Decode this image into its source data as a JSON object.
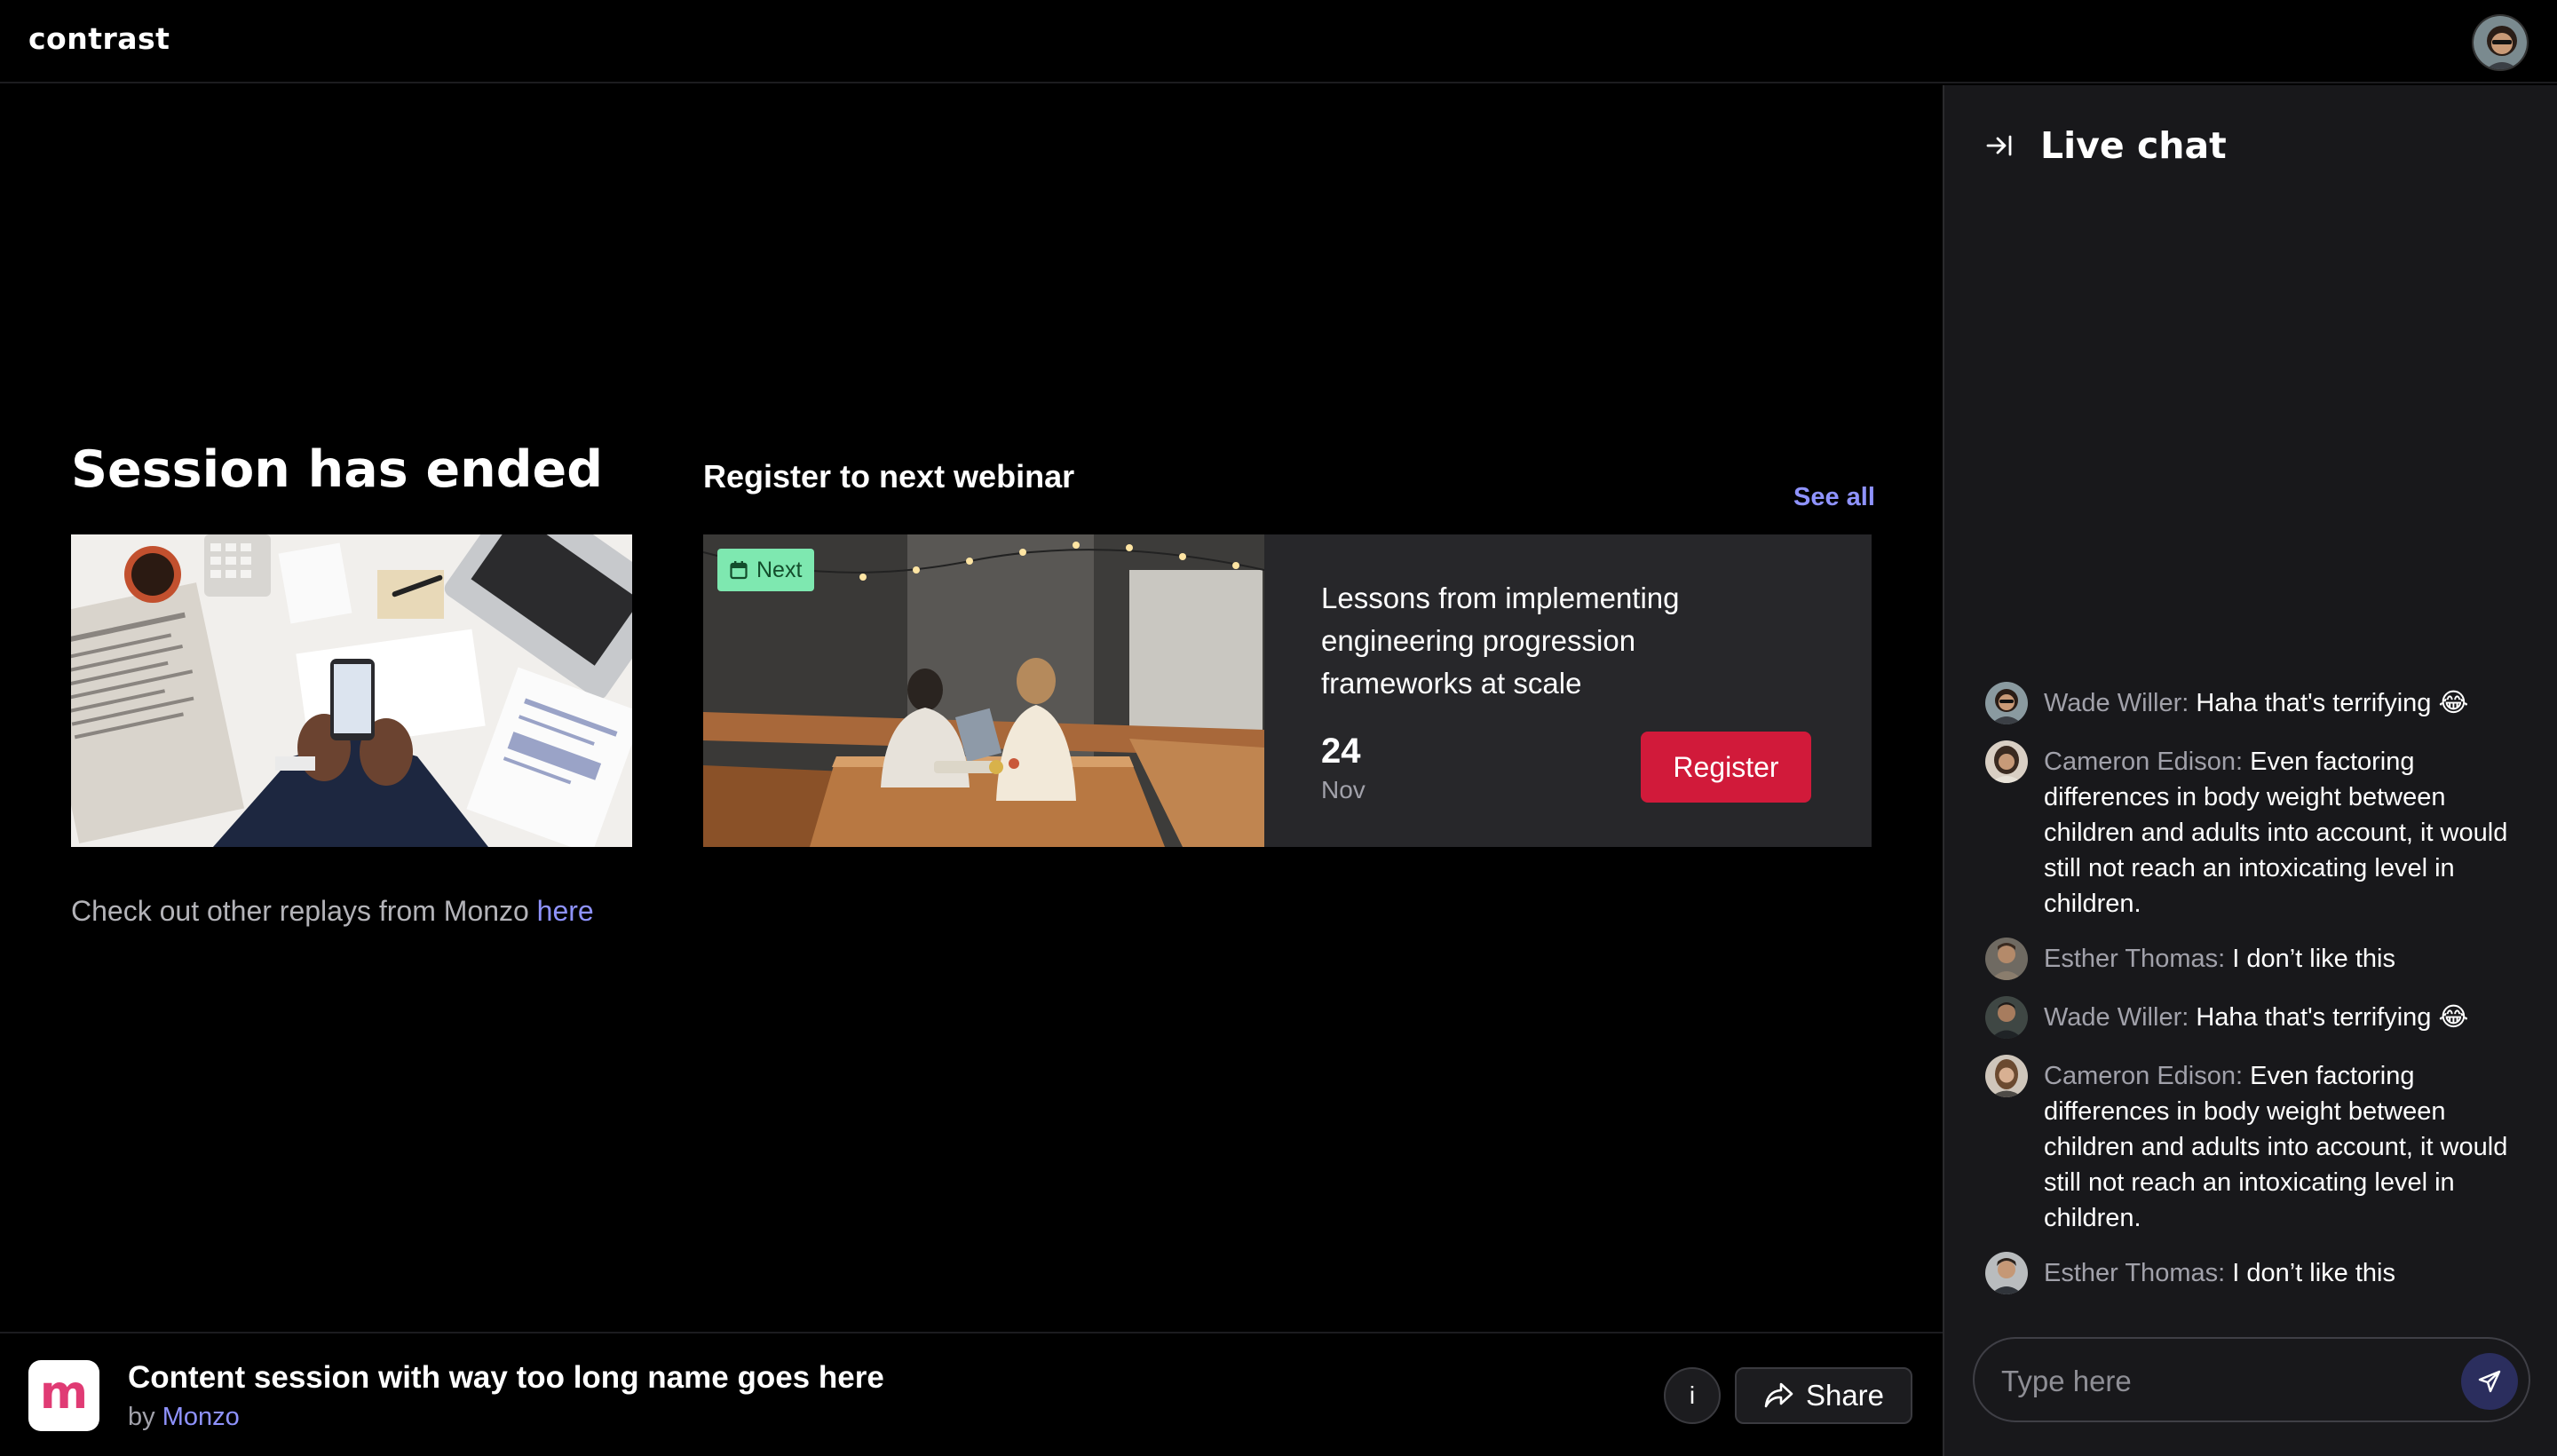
{
  "app": {
    "logo_text": "contrast"
  },
  "user": {
    "avatar_icon": "user-avatar"
  },
  "stage": {
    "session_title": "Session has ended",
    "replays_text": "Check out other replays from Monzo ",
    "replays_link": "here",
    "register_heading": "Register to next webinar",
    "see_all": "See all",
    "next_card": {
      "badge": "Next",
      "title": "Lessons from implementing engineering progression frameworks at scale",
      "day": "24",
      "month": "Nov",
      "register_label": "Register"
    }
  },
  "bottom": {
    "org_letter": "m",
    "content_title": "Content session with way too long name goes here",
    "by_label": "by ",
    "org_name": "Monzo",
    "info_label": "i",
    "share_label": "Share"
  },
  "chat": {
    "title": "Live chat",
    "messages": [
      {
        "author": "Wade Willer:",
        "text": " Haha that's terrifying 😂"
      },
      {
        "author": "Cameron Edison:",
        "text": " Even factoring differences in body weight between children and adults into account, it would still not reach an intoxicating level in children."
      },
      {
        "author": "Esther Thomas:",
        "text": " I don’t like this"
      },
      {
        "author": "Wade Willer:",
        "text": " Haha that's terrifying 😂"
      },
      {
        "author": "Cameron Edison:",
        "text": " Even factoring differences in body weight between children and adults into account, it would still not reach an intoxicating level in children."
      },
      {
        "author": "Esther Thomas:",
        "text": " I don’t like this"
      }
    ],
    "input_placeholder": "Type here"
  },
  "colors": {
    "accent": "#8f93ff",
    "register": "#d11a3a",
    "badge": "#7ee8b0",
    "panel": "#18181b"
  }
}
